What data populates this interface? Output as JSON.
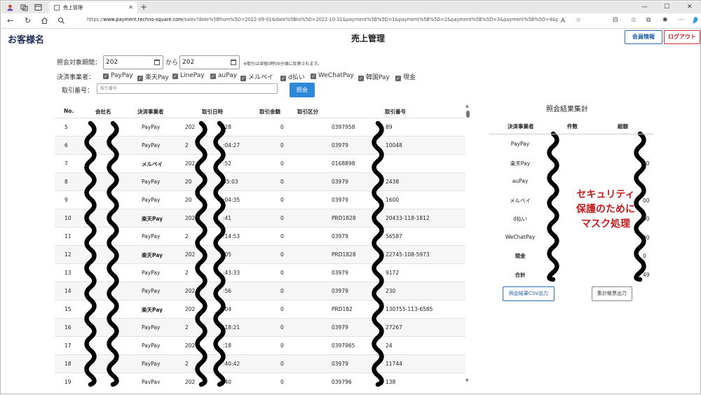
{
  "browser": {
    "tab_title": "売上管理",
    "tab_close": "✕",
    "new_tab": "+",
    "url_prefix": "https://",
    "url_host": "www.payment.techno-square.com",
    "url_path": "/sales?date%5Bfrom%5D=2022-09-01&date%5Bto%5D=2022-10-31&payment%5B%5D=1&payment%5B%5D=2&payment%5B%5D=3&payment%5B%5D=4&pay..."
  },
  "header": {
    "customer": "お客様名",
    "title": "売上管理",
    "member_button": "会員情報",
    "logout_button": "ログアウト"
  },
  "filter": {
    "period_label": "照会対象期間：",
    "date_from": "202",
    "date_to": "202",
    "between": "から",
    "note": "※取引は深夜0時00分頃に反映されます。",
    "provider_label": "決済事業者：",
    "providers": [
      "PayPay",
      "楽天Pay",
      "LinePay",
      "auPay",
      "メルペイ",
      "d払い",
      "WeChatPay",
      "韓国Pay",
      "現金"
    ],
    "check_mark": "✓",
    "txn_label": "取引番号：",
    "txn_placeholder": "取引番号",
    "search_button": "照会"
  },
  "table": {
    "headers": [
      "No.",
      "会社名",
      "決済事業者",
      "取引日時",
      "取引金額",
      "取引区分",
      "取引番号"
    ],
    "rows": [
      {
        "no": "5",
        "provider": "PayPay",
        "dt_a": "202",
        "dt_b": ":28",
        "amt": "0",
        "id_a": "0397958",
        "id_b": "89",
        "bold": false
      },
      {
        "no": "6",
        "provider": "PayPay",
        "dt_a": "2",
        "dt_b": ":04:27",
        "amt": "0",
        "id_a": "03979",
        "id_b": "10048",
        "bold": false
      },
      {
        "no": "7",
        "provider": "メルペイ",
        "dt_a": "202",
        "dt_b": ":52",
        "amt": "0",
        "id_a": "0168898",
        "id_b": "",
        "bold": true
      },
      {
        "no": "8",
        "provider": "PayPay",
        "dt_a": "20",
        "dt_b": "35:03",
        "amt": "0",
        "id_a": "03979",
        "id_b": "2438",
        "bold": false
      },
      {
        "no": "9",
        "provider": "PayPay",
        "dt_a": "20",
        "dt_b": ":04:35",
        "amt": "0",
        "id_a": "03979",
        "id_b": "1600",
        "bold": false
      },
      {
        "no": "10",
        "provider": "楽天Pay",
        "dt_a": "202",
        "dt_b": ":41",
        "amt": "0",
        "id_a": "PRD1828",
        "id_b": "20433-118-1812",
        "bold": true
      },
      {
        "no": "11",
        "provider": "PayPay",
        "dt_a": "2",
        "dt_b": ":14:53",
        "amt": "0",
        "id_a": "03979",
        "id_b": "56587",
        "bold": false
      },
      {
        "no": "12",
        "provider": "楽天Pay",
        "dt_a": "202",
        "dt_b": ":05",
        "amt": "0",
        "id_a": "PRD1828",
        "id_b": "22745-108-5973",
        "bold": true
      },
      {
        "no": "13",
        "provider": "PayPay",
        "dt_a": "2",
        "dt_b": ":43:33",
        "amt": "0",
        "id_a": "03979",
        "id_b": "9172",
        "bold": false
      },
      {
        "no": "14",
        "provider": "PayPay",
        "dt_a": "202",
        "dt_b": ":56",
        "amt": "0",
        "id_a": "03979",
        "id_b": "230",
        "bold": false
      },
      {
        "no": "15",
        "provider": "楽天Pay",
        "dt_a": "202",
        "dt_b": ":04",
        "amt": "0",
        "id_a": "PRD182",
        "id_b": "130755-113-6585",
        "bold": true
      },
      {
        "no": "16",
        "provider": "PayPay",
        "dt_a": "2",
        "dt_b": ":18:21",
        "amt": "0",
        "id_a": "03979",
        "id_b": "27267",
        "bold": false
      },
      {
        "no": "17",
        "provider": "PayPay",
        "dt_a": "202",
        "dt_b": ":18",
        "amt": "0",
        "id_a": "0397965",
        "id_b": "24",
        "bold": false
      },
      {
        "no": "18",
        "provider": "PayPay",
        "dt_a": "2",
        "dt_b": ":40:42",
        "amt": "0",
        "id_a": "03979",
        "id_b": "11744",
        "bold": false
      },
      {
        "no": "19",
        "provider": "PayPay",
        "dt_a": "202",
        "dt_b": ":40",
        "amt": "0",
        "id_a": "039796",
        "id_b": "138",
        "bold": false
      }
    ]
  },
  "summary": {
    "title": "照会結果集計",
    "headers": [
      "決済事業者",
      "件数",
      "総額"
    ],
    "rows": [
      {
        "provider": "PayPay",
        "total": ""
      },
      {
        "provider": "楽天Pay",
        "total": "00"
      },
      {
        "provider": "auPay",
        "total": ""
      },
      {
        "provider": "メルペイ",
        "total": "00"
      },
      {
        "provider": "d払い",
        "total": "00"
      },
      {
        "provider": "WeChatPay",
        "total": "00"
      },
      {
        "provider": "現金",
        "total": "0"
      },
      {
        "provider": "合計",
        "total": "49"
      }
    ],
    "mask_note_1": "セキュリティ",
    "mask_note_2": "保護のために",
    "mask_note_3": "マスク処理",
    "csv_button": "照会結果CSV出力",
    "report_button": "集計帳票出力"
  },
  "colors": {
    "customer": "#1f2d5a",
    "primary": "#2f87d8",
    "logout": "#c22222",
    "mask_note": "#c21b1b"
  }
}
